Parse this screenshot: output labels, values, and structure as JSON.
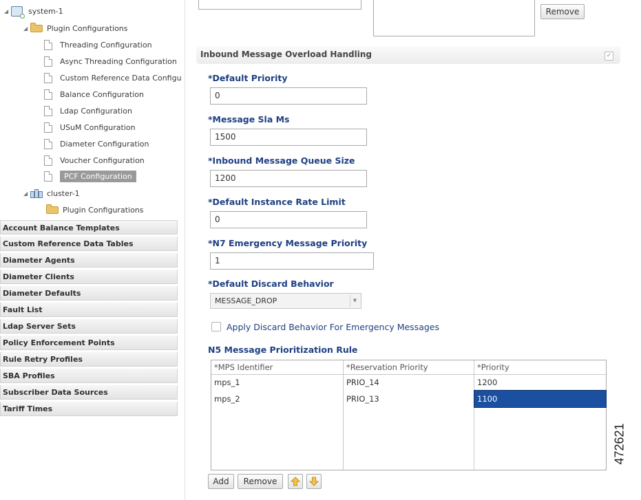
{
  "tree": {
    "system": "system-1",
    "system_plugins": "Plugin Configurations",
    "items": [
      "Threading Configuration",
      "Async Threading Configuration",
      "Custom Reference Data Configu",
      "Balance Configuration",
      "Ldap Configuration",
      "USuM Configuration",
      "Diameter Configuration",
      "Voucher Configuration",
      "PCF Configuration"
    ],
    "cluster": "cluster-1",
    "cluster_plugins": "Plugin Configurations"
  },
  "sections": [
    "Account Balance Templates",
    "Custom Reference Data Tables",
    "Diameter Agents",
    "Diameter Clients",
    "Diameter Defaults",
    "Fault List",
    "Ldap Server Sets",
    "Policy Enforcement Points",
    "Rule Retry Profiles",
    "SBA Profiles",
    "Subscriber Data Sources",
    "Tariff Times"
  ],
  "top": {
    "remove_label": "Remove"
  },
  "overload": {
    "title": "Inbound Message Overload Handling",
    "check_mark": "✓",
    "fields": {
      "default_priority": {
        "label": "*Default Priority",
        "value": "0"
      },
      "message_sla_ms": {
        "label": "*Message Sla Ms",
        "value": "1500"
      },
      "queue_size": {
        "label": "*Inbound Message Queue Size",
        "value": "1200"
      },
      "rate_limit": {
        "label": "*Default Instance Rate Limit",
        "value": "0"
      },
      "n7_priority": {
        "label": "*N7 Emergency Message Priority",
        "value": "1"
      }
    },
    "discard": {
      "label": "*Default Discard Behavior",
      "value": "MESSAGE_DROP"
    },
    "emergency_checkbox": {
      "label": "Apply Discard Behavior For Emergency Messages",
      "checked": false
    },
    "rule": {
      "title": "N5 Message Prioritization Rule",
      "columns": [
        "*MPS Identifier",
        "*Reservation Priority",
        "*Priority"
      ],
      "rows": [
        [
          "mps_1",
          "PRIO_14",
          "1200"
        ],
        [
          "mps_2",
          "PRIO_13",
          "1100"
        ]
      ],
      "selected": {
        "row": 1,
        "col": 2
      }
    },
    "buttons": {
      "add": "Add",
      "remove": "Remove"
    }
  },
  "figure_id": "472621",
  "colors": {
    "label_blue": "#1e3f82",
    "selection": "#1b4fa0",
    "folder": "#e9c46a"
  }
}
